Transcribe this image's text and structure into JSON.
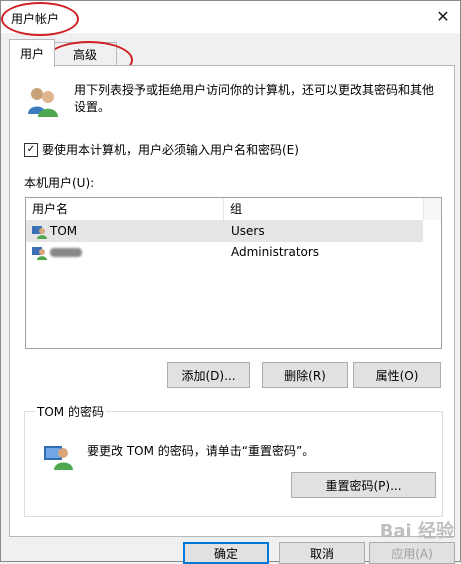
{
  "window": {
    "title": "用户帐户",
    "close_glyph": "✕"
  },
  "tabs": [
    {
      "label": "用户"
    },
    {
      "label": "高级"
    }
  ],
  "intro_text": "用下列表授予或拒绝用户访问你的计算机，还可以更改其密码和其他设置。",
  "require_login": {
    "checked": true,
    "label": "要使用本计算机，用户必须输入用户名和密码(E)"
  },
  "users_section": {
    "label": "本机用户(U):",
    "columns": [
      "用户名",
      "组"
    ],
    "rows": [
      {
        "name": "TOM",
        "group": "Users",
        "selected": true
      },
      {
        "name": "",
        "group": "Administrators",
        "selected": false
      }
    ]
  },
  "list_buttons": {
    "add": "添加(D)...",
    "remove": "删除(R)",
    "properties": "属性(O)"
  },
  "password_box": {
    "title": "TOM 的密码",
    "text": "要更改 TOM 的密码，请单击“重置密码”。",
    "reset_button": "重置密码(P)..."
  },
  "dialog_buttons": {
    "ok": "确定",
    "cancel": "取消",
    "apply": "应用(A)"
  },
  "watermark": "Bai 经验",
  "colors": {
    "annotation_red": "#d01f24",
    "focus_blue": "#0078d7"
  }
}
